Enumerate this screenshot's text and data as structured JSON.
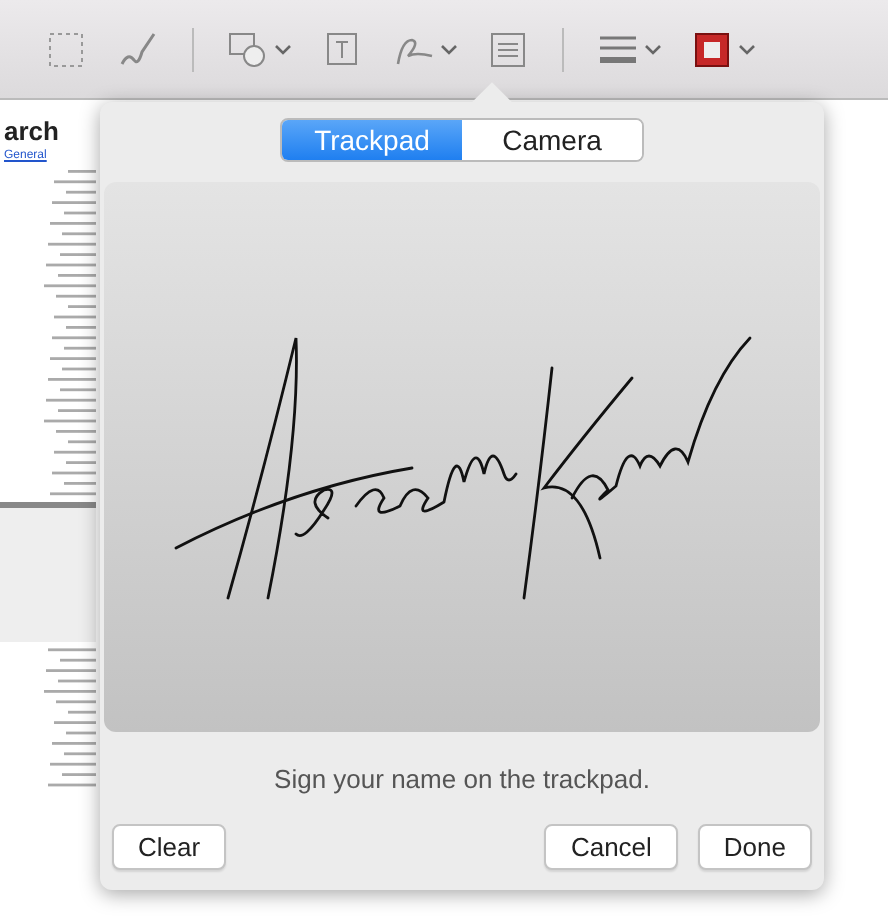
{
  "document": {
    "heading": "arch",
    "link": "General"
  },
  "signature_popover": {
    "tabs": [
      {
        "label": "Trackpad",
        "selected": true
      },
      {
        "label": "Camera",
        "selected": false
      }
    ],
    "caption": "Sign your name on the trackpad.",
    "left_buttons": [
      "Clear"
    ],
    "right_buttons": [
      "Cancel",
      "Done"
    ]
  }
}
